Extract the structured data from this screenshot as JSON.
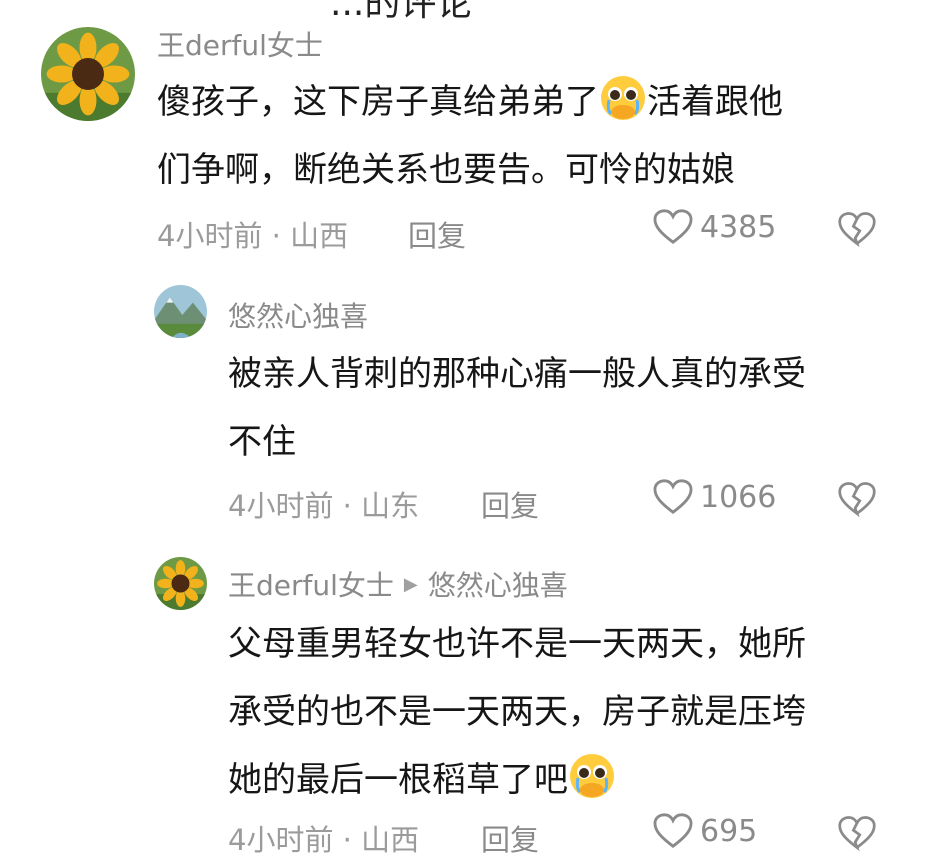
{
  "header_cut": "...的评论",
  "comments": [
    {
      "user": "王derful女士",
      "text_line1a": "傻孩子，这下房子真给弟弟了",
      "text_line1b": "活着跟他",
      "text_line2": "们争啊，断绝关系也要告。可怜的姑娘",
      "time_location": "4小时前 · 山西",
      "reply_label": "回复",
      "likes": "4385"
    },
    {
      "user": "悠然心独喜",
      "text_line1": "被亲人背刺的那种心痛一般人真的承受",
      "text_line2": "不住",
      "time_location": "4小时前 · 山东",
      "reply_label": "回复",
      "likes": "1066"
    },
    {
      "user": "王derful女士",
      "reply_to": "悠然心独喜",
      "text_line1": "父母重男轻女也许不是一天两天，她所",
      "text_line2": "承受的也不是一天两天，房子就是压垮",
      "text_line3a": "她的最后一根稻草了吧",
      "time_location": "4小时前 · 山西",
      "reply_label": "回复",
      "likes": "695"
    }
  ],
  "icons": {
    "like": "heart-outline-icon",
    "dislike": "broken-heart-icon",
    "emoji": "pleading-face-emoji"
  }
}
